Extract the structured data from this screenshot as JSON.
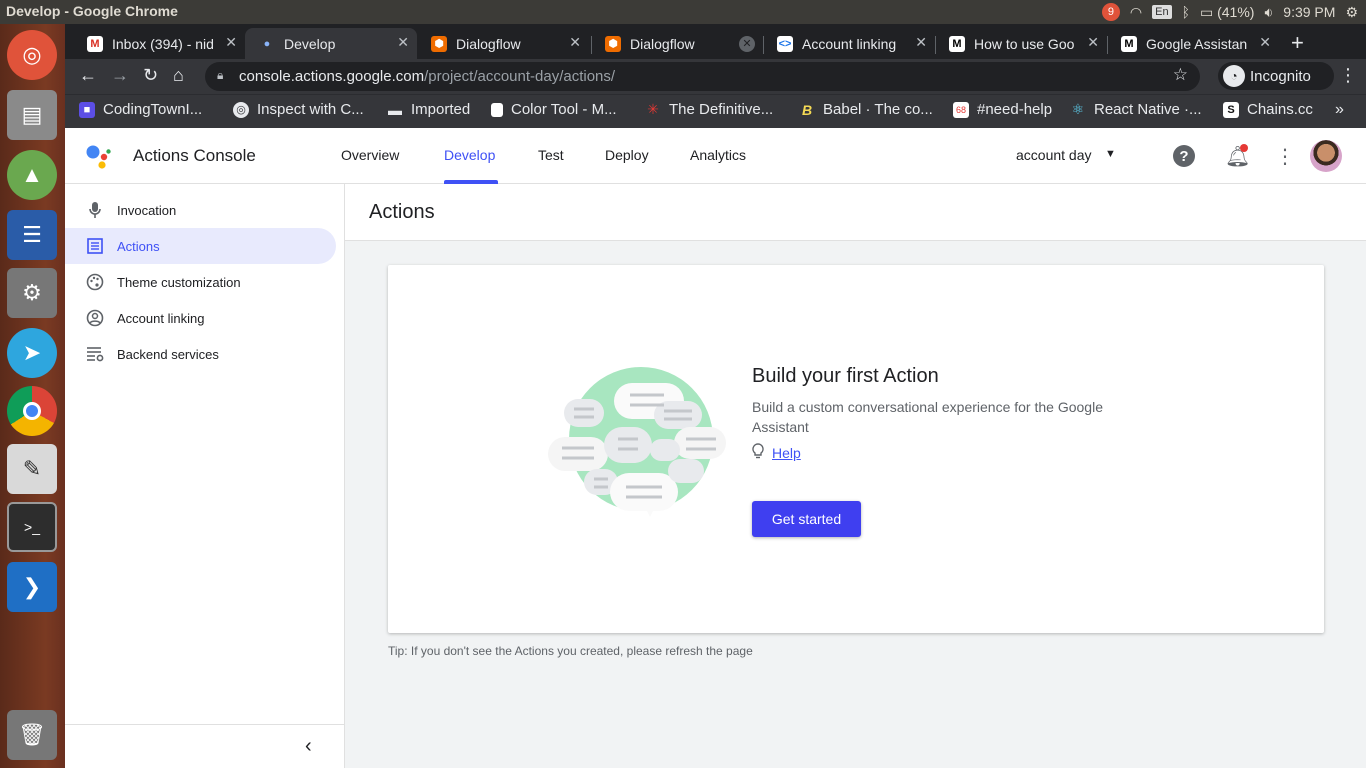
{
  "os": {
    "window_title": "Develop - Google Chrome",
    "notif_count": "9",
    "keyboard": "En",
    "battery": "(41%)",
    "time": "9:39 PM"
  },
  "launcher": {
    "apps": [
      "ubuntu-dash",
      "files",
      "android-studio",
      "libreoffice-writer",
      "system-settings",
      "telegram",
      "chrome",
      "text-editor",
      "terminal",
      "vscode",
      "trash"
    ]
  },
  "tabs": [
    {
      "title": "Inbox (394) - nid",
      "icon": "gmail-icon"
    },
    {
      "title": "Develop",
      "icon": "actions-icon",
      "active": true
    },
    {
      "title": "Dialogflow",
      "icon": "dialogflow-icon"
    },
    {
      "title": "Dialogflow",
      "icon": "dialogflow-icon"
    },
    {
      "title": "Account linking",
      "icon": "google-dev-icon"
    },
    {
      "title": "How to use Goo",
      "icon": "medium-icon"
    },
    {
      "title": "Google Assistan",
      "icon": "medium-icon"
    }
  ],
  "address": {
    "domain": "console.actions.google.com",
    "path": "/project/account-day/actions/"
  },
  "incognito_label": "Incognito",
  "bookmarks": [
    {
      "label": "CodingTownI...",
      "icon": "codingtown-icon"
    },
    {
      "label": "Inspect with C...",
      "icon": "globe-icon"
    },
    {
      "label": "Imported",
      "icon": "folder-icon"
    },
    {
      "label": "Color Tool - M...",
      "icon": "page-icon"
    },
    {
      "label": "The Definitive...",
      "icon": "spark-icon"
    },
    {
      "label": "Babel · The co...",
      "icon": "babel-icon"
    },
    {
      "label": "#need-help",
      "icon": "discord-icon"
    },
    {
      "label": "React Native ·...",
      "icon": "react-icon"
    },
    {
      "label": "Chains.cc",
      "icon": "chains-icon"
    }
  ],
  "app": {
    "brand": "Actions Console",
    "nav": [
      "Overview",
      "Develop",
      "Test",
      "Deploy",
      "Analytics"
    ],
    "active_nav": "Develop",
    "project": "account day"
  },
  "sidebar": {
    "items": [
      {
        "label": "Invocation",
        "icon": "microphone-icon"
      },
      {
        "label": "Actions",
        "icon": "list-icon",
        "active": true
      },
      {
        "label": "Theme customization",
        "icon": "palette-icon"
      },
      {
        "label": "Account linking",
        "icon": "account-circle-icon"
      },
      {
        "label": "Backend services",
        "icon": "settings-list-icon"
      }
    ]
  },
  "main": {
    "title": "Actions",
    "card": {
      "heading": "Build your first Action",
      "description": "Build a custom conversational experience for the Google Assistant",
      "help": "Help",
      "button": "Get started"
    },
    "tip": "Tip: If you don't see the Actions you created, please refresh the page"
  },
  "colors": {
    "accent": "#3f51f5",
    "button": "#3f3ff0",
    "illustration_bg": "#a8e6c0"
  }
}
